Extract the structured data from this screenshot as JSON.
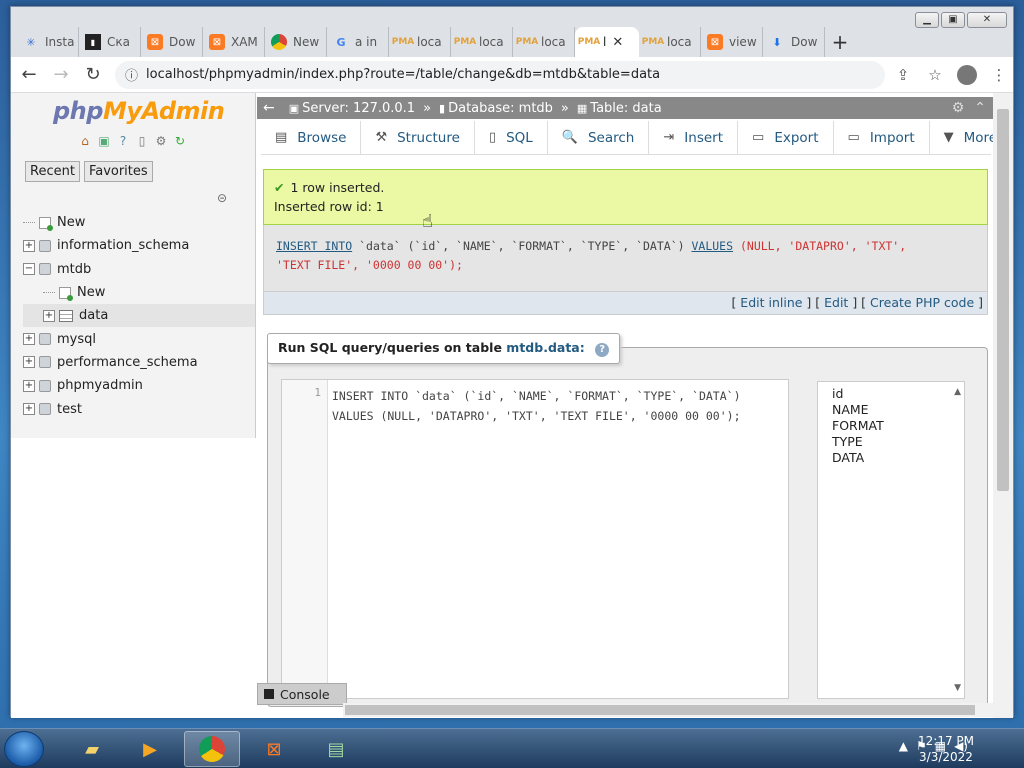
{
  "browser": {
    "tabs": [
      {
        "label": "Insta",
        "icon": "star-icon",
        "fav": "star",
        "glyph": "✳"
      },
      {
        "label": "Ска",
        "icon": "terminal-icon",
        "fav": "cmd",
        "glyph": "▮"
      },
      {
        "label": "Dow",
        "icon": "xampp-icon",
        "fav": "xampp",
        "glyph": "⊠"
      },
      {
        "label": "XAM",
        "icon": "xampp-icon",
        "fav": "xampp",
        "glyph": "⊠"
      },
      {
        "label": "New",
        "icon": "chrome-icon",
        "fav": "chrome",
        "glyph": ""
      },
      {
        "label": "a in",
        "icon": "google-icon",
        "fav": "google",
        "glyph": "G"
      },
      {
        "label": "loca",
        "icon": "pma-icon",
        "fav": "pma",
        "glyph": "PMA"
      },
      {
        "label": "loca",
        "icon": "pma-icon",
        "fav": "pma",
        "glyph": "PMA"
      },
      {
        "label": "loca",
        "icon": "pma-icon",
        "fav": "pma",
        "glyph": "PMA"
      },
      {
        "label": "l",
        "icon": "pma-icon",
        "fav": "pma",
        "glyph": "PMA",
        "active": true
      },
      {
        "label": "loca",
        "icon": "pma-icon",
        "fav": "pma",
        "glyph": "PMA"
      },
      {
        "label": "view",
        "icon": "xampp-icon",
        "fav": "xampp",
        "glyph": "⊠"
      },
      {
        "label": "Dow",
        "icon": "download-icon",
        "fav": "dl",
        "glyph": "⬇"
      }
    ],
    "new_tab": "+",
    "url": "localhost/phpmyadmin/index.php?route=/table/change&db=mtdb&table=data"
  },
  "pma": {
    "logo": {
      "php": "php",
      "my": "My",
      "admin": "Admin"
    },
    "nav_tabs": {
      "recent": "Recent",
      "favorites": "Favorites"
    },
    "tree": [
      {
        "label": "New",
        "kind": "new",
        "level": 0
      },
      {
        "label": "information_schema",
        "kind": "db",
        "level": 0,
        "exp": "+"
      },
      {
        "label": "mtdb",
        "kind": "db",
        "level": 0,
        "exp": "−"
      },
      {
        "label": "New",
        "kind": "new",
        "level": 1
      },
      {
        "label": "data",
        "kind": "table",
        "level": 1,
        "exp": "+",
        "selected": true
      },
      {
        "label": "mysql",
        "kind": "db",
        "level": 0,
        "exp": "+"
      },
      {
        "label": "performance_schema",
        "kind": "db",
        "level": 0,
        "exp": "+"
      },
      {
        "label": "phpmyadmin",
        "kind": "db",
        "level": 0,
        "exp": "+"
      },
      {
        "label": "test",
        "kind": "db",
        "level": 0,
        "exp": "+"
      }
    ],
    "breadcrumb": {
      "server": "Server: 127.0.0.1",
      "database": "Database: mtdb",
      "table": "Table: data",
      "sep": "»"
    },
    "menu": [
      {
        "label": "Browse",
        "icon": "browse-icon",
        "glyph": "▤"
      },
      {
        "label": "Structure",
        "icon": "structure-icon",
        "glyph": "⚒"
      },
      {
        "label": "SQL",
        "icon": "sql-icon",
        "glyph": "▯"
      },
      {
        "label": "Search",
        "icon": "search-icon",
        "glyph": "🔍"
      },
      {
        "label": "Insert",
        "icon": "insert-icon",
        "glyph": "⇥"
      },
      {
        "label": "Export",
        "icon": "export-icon",
        "glyph": "▭"
      },
      {
        "label": "Import",
        "icon": "import-icon",
        "glyph": "▭"
      },
      {
        "label": "More",
        "icon": "chevron-down-icon",
        "glyph": "▼"
      }
    ],
    "success": {
      "line1": "1 row inserted.",
      "line2": "Inserted row id: 1"
    },
    "query": {
      "insert_into": "INSERT INTO",
      "table": "`data`",
      "cols": "(`id`, `NAME`, `FORMAT`, `TYPE`, `DATA`)",
      "values_kw": "VALUES",
      "vals_line1": "(NULL, 'DATAPRO', 'TXT',",
      "vals_line2": "'TEXT FILE', '0000 00 00');"
    },
    "query_links": {
      "edit_inline": "Edit inline",
      "edit": "Edit",
      "create_php": "Create PHP code"
    },
    "run_sql": {
      "label": "Run SQL query/queries on table",
      "table": "mtdb.data:",
      "line_no": "1",
      "code_line1": "INSERT INTO `data` (`id`, `NAME`, `FORMAT`, `TYPE`, `DATA`)",
      "code_line2": "VALUES (NULL, 'DATAPRO', 'TXT', 'TEXT FILE', '0000 00 00');"
    },
    "columns": [
      "id",
      "NAME",
      "FORMAT",
      "TYPE",
      "DATA"
    ],
    "console": "Console"
  },
  "taskbar": {
    "time": "12:17 PM",
    "date": "3/3/2022"
  }
}
